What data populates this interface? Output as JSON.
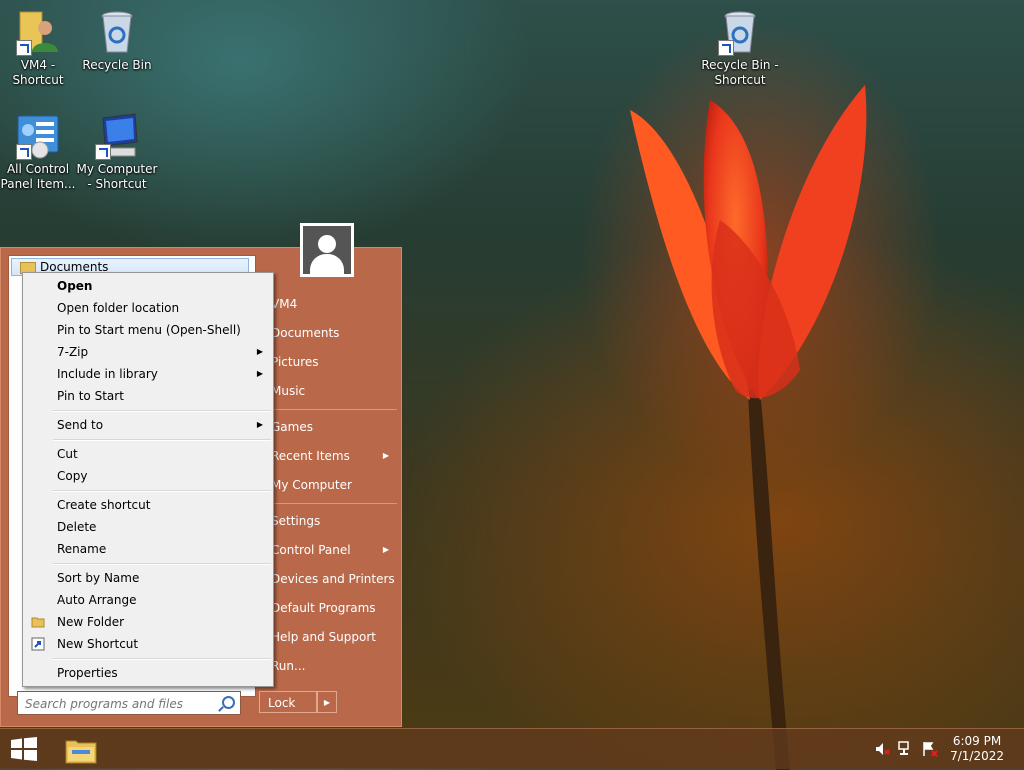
{
  "desktop": {
    "icons": [
      {
        "label_lines": [
          "VM4 -",
          "Shortcut"
        ]
      },
      {
        "label_lines": [
          "Recycle Bin"
        ]
      },
      {
        "label_lines": [
          "All Control",
          "Panel Item..."
        ]
      },
      {
        "label_lines": [
          "My Computer",
          "- Shortcut"
        ]
      },
      {
        "label_lines": [
          "Recycle Bin -",
          "Shortcut"
        ]
      }
    ]
  },
  "start_menu": {
    "selected_program": "Documents",
    "search": {
      "placeholder": "Search programs and files"
    },
    "right_items": [
      {
        "label": "VM4",
        "has_submenu": false
      },
      {
        "label": "Documents",
        "has_submenu": false
      },
      {
        "label": "Pictures",
        "has_submenu": false
      },
      {
        "label": "Music",
        "has_submenu": false
      },
      {
        "label": "Games",
        "has_submenu": false
      },
      {
        "label": "Recent Items",
        "has_submenu": true
      },
      {
        "label": "My Computer",
        "has_submenu": false
      },
      {
        "label": "Settings",
        "has_submenu": false
      },
      {
        "label": "Control Panel",
        "has_submenu": true
      },
      {
        "label": "Devices and Printers",
        "has_submenu": false
      },
      {
        "label": "Default Programs",
        "has_submenu": false
      },
      {
        "label": "Help and Support",
        "has_submenu": false
      },
      {
        "label": "Run...",
        "has_submenu": false
      }
    ],
    "lock_label": "Lock",
    "lock_arrow": "▶"
  },
  "context_menu": {
    "items": [
      {
        "label": "Open",
        "bold": true
      },
      {
        "label": "Open folder location"
      },
      {
        "label": "Pin to Start menu (Open-Shell)"
      },
      {
        "label": "7-Zip",
        "submenu": true
      },
      {
        "label": "Include in library",
        "submenu": true
      },
      {
        "label": "Pin to Start"
      },
      {
        "label": "Send to",
        "submenu": true
      },
      {
        "label": "Cut"
      },
      {
        "label": "Copy"
      },
      {
        "label": "Create shortcut"
      },
      {
        "label": "Delete"
      },
      {
        "label": "Rename"
      },
      {
        "label": "Sort by Name"
      },
      {
        "label": "Auto Arrange"
      },
      {
        "label": "New Folder",
        "icon": "folder-icon"
      },
      {
        "label": "New Shortcut",
        "icon": "shortcut-icon"
      },
      {
        "label": "Properties"
      }
    ]
  },
  "taskbar": {
    "time": "6:09 PM",
    "date": "7/1/2022"
  },
  "colors": {
    "start_menu_bg": "#b9694a",
    "selection_blue": "#d5e6fa"
  }
}
